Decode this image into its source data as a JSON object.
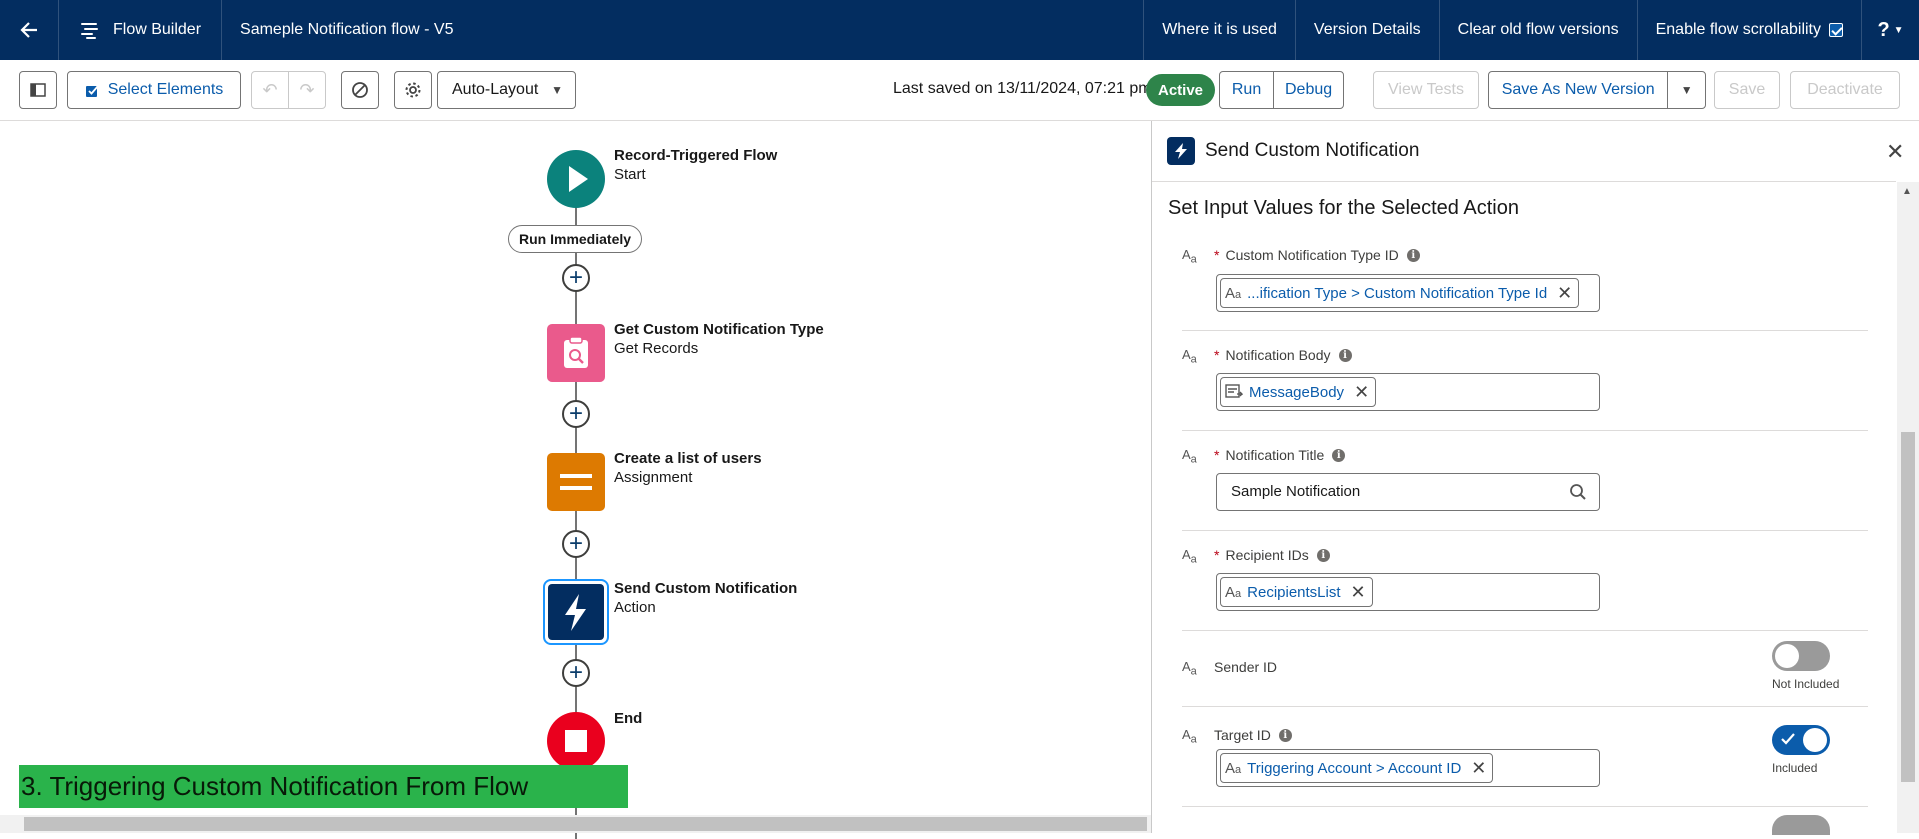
{
  "topbar": {
    "app_name": "Flow Builder",
    "flow_name": "Sameple Notification flow - V5",
    "links": [
      "Where it is used",
      "Version Details",
      "Clear old flow versions"
    ],
    "scroll_label": "Enable flow scrollability",
    "scroll_checked": true,
    "help": "?"
  },
  "toolbar": {
    "select_elements": "Select Elements",
    "layout": "Auto-Layout",
    "last_saved": "Last saved on 13/11/2024, 07:21 pm",
    "status": "Active",
    "run": "Run",
    "debug": "Debug",
    "view_tests": "View Tests",
    "save_as_new": "Save As New Version",
    "save": "Save",
    "deactivate": "Deactivate"
  },
  "canvas": {
    "run_immediately": "Run Immediately",
    "nodes": [
      {
        "title": "Record-Triggered Flow",
        "subtitle": "Start",
        "color": "#0b827c"
      },
      {
        "title": "Get Custom Notification Type",
        "subtitle": "Get Records",
        "color": "#ea5a8c"
      },
      {
        "title": "Create a list of users",
        "subtitle": "Assignment",
        "color": "#dd7a01"
      },
      {
        "title": "Send Custom Notification",
        "subtitle": "Action",
        "color": "#032d60"
      },
      {
        "title": "End",
        "subtitle": "",
        "color": "#ea001e"
      }
    ],
    "banner": "3. Triggering Custom Notification From Flow",
    "banner_color": "#2ab34b"
  },
  "panel": {
    "title": "Send Custom Notification",
    "section": "Set Input Values for the Selected Action",
    "fields": [
      {
        "label": "Custom Notification Type ID",
        "required": true,
        "value": "...ification Type > Custom Notification Type Id"
      },
      {
        "label": "Notification Body",
        "required": true,
        "value": "MessageBody"
      },
      {
        "label": "Notification Title",
        "required": true,
        "value": "Sample Notification"
      },
      {
        "label": "Recipient IDs",
        "required": true,
        "value": "RecipientsList"
      },
      {
        "label": "Sender ID",
        "required": false,
        "toggle": "Not Included"
      },
      {
        "label": "Target ID",
        "required": false,
        "value": "Triggering Account > Account ID",
        "toggle": "Included"
      }
    ],
    "aa": "A"
  }
}
